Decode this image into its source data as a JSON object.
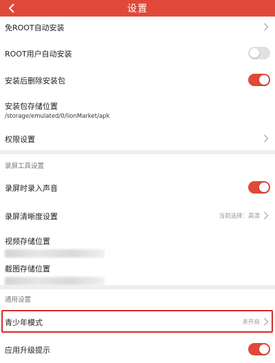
{
  "header": {
    "title": "设置",
    "back_icon": "back-arrow-icon"
  },
  "rows": {
    "no_root_install": {
      "label": "免ROOT自动安装"
    },
    "root_install": {
      "label": "ROOT用户自动安装",
      "toggle": "off"
    },
    "delete_after_install": {
      "label": "安装后删除安装包",
      "toggle": "on"
    },
    "package_location": {
      "label": "安装包存储位置",
      "path": "/storage/emulated/0/lionMarket/apk"
    },
    "permissions": {
      "label": "权限设置"
    }
  },
  "screen_recording": {
    "section_title": "录屏工具设置",
    "record_audio": {
      "label": "录屏时录入声音",
      "toggle": "on"
    },
    "clarity": {
      "label": "录屏清晰度设置",
      "value": "当前选择：高清"
    },
    "video_location": {
      "label": "视频存储位置"
    },
    "screenshot_location": {
      "label": "截图存储位置"
    }
  },
  "general": {
    "section_title": "通用设置",
    "teen_mode": {
      "label": "青少年模式",
      "value": "未开启"
    },
    "upgrade_notice": {
      "label": "应用升级提示",
      "toggle": "on"
    }
  },
  "colors": {
    "accent": "#e0483a",
    "highlight": "#d42a2a"
  }
}
